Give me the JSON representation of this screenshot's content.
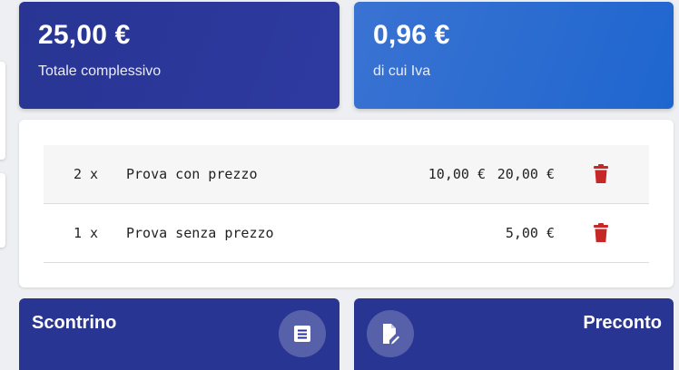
{
  "totals": {
    "grand_total": {
      "amount": "25,00 €",
      "caption": "Totale complessivo"
    },
    "vat": {
      "amount": "0,96 €",
      "caption": "di cui Iva"
    }
  },
  "order_lines": [
    {
      "qty": "2 x",
      "description": "Prova con prezzo",
      "unit_price": "10,00 €",
      "line_total": "20,00 €",
      "delete_icon": "trash-icon"
    },
    {
      "qty": "1 x",
      "description": "Prova senza prezzo",
      "unit_price": "",
      "line_total": "5,00 €",
      "delete_icon": "trash-icon"
    }
  ],
  "actions": {
    "receipt": {
      "label": "Scontrino",
      "icon": "receipt-icon"
    },
    "preaccount": {
      "label": "Preconto",
      "icon": "document-edit-icon"
    }
  },
  "colors": {
    "primary": "#283593",
    "vat_card": "#1e66cf",
    "delete": "#c62828",
    "background": "#eeeff2"
  }
}
